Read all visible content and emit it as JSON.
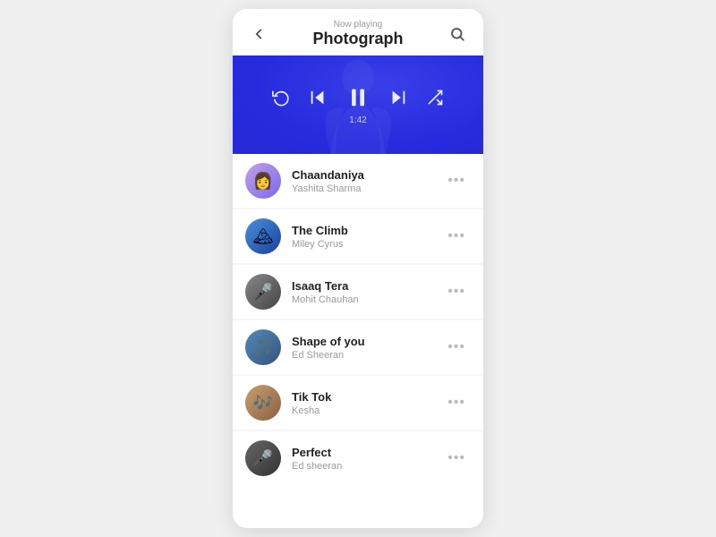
{
  "header": {
    "now_playing_label": "Now playing",
    "song_title": "Photograph",
    "back_icon": "←",
    "search_icon": "🔍"
  },
  "player": {
    "time": "1:42",
    "controls": {
      "replay_icon": "↺",
      "prev_icon": "⏮",
      "pause_icon": "⏸",
      "next_icon": "⏭",
      "shuffle_icon": "⇌"
    }
  },
  "songs": [
    {
      "id": 1,
      "name": "Chaandaniya",
      "artist": "Yashita Sharma",
      "avatar_class": "av-1",
      "avatar_emoji": "👩"
    },
    {
      "id": 2,
      "name": "The Climb",
      "artist": "Miley Cyrus",
      "avatar_class": "av-2",
      "avatar_emoji": "🏔"
    },
    {
      "id": 3,
      "name": "Isaaq Tera",
      "artist": "Mohit Chauhan",
      "avatar_class": "av-3",
      "avatar_emoji": "🎤"
    },
    {
      "id": 4,
      "name": "Shape of you",
      "artist": "Ed Sheeran",
      "avatar_class": "av-4",
      "avatar_emoji": "🎵"
    },
    {
      "id": 5,
      "name": "Tik Tok",
      "artist": "Kesha",
      "avatar_class": "av-5",
      "avatar_emoji": "🎶"
    },
    {
      "id": 6,
      "name": "Perfect",
      "artist": "Ed sheeran",
      "avatar_class": "av-6",
      "avatar_emoji": "🎤"
    }
  ],
  "more_button_label": "•••"
}
